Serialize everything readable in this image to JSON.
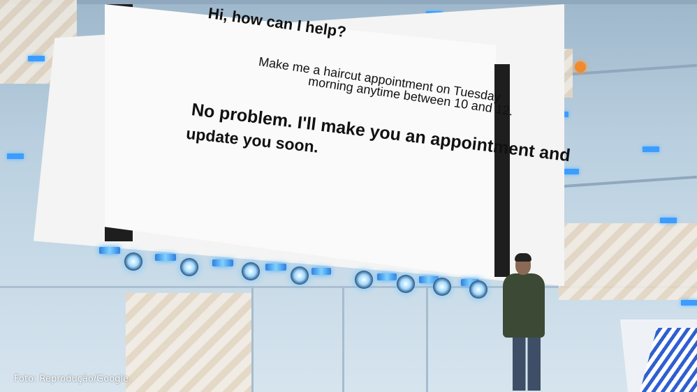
{
  "screen": {
    "line1": "Hi, how can I help?",
    "line2": "Make me a haircut appointment on Tuesday",
    "line3": "morning anytime between 10 and 12.",
    "line4": "No problem. I'll make you an appointment and",
    "line5": "update you soon."
  },
  "caption": {
    "credit": "Foto: Reprodução/Google."
  },
  "colors": {
    "accent_light": "#3c9cff",
    "stage": "#c9dbe8"
  }
}
